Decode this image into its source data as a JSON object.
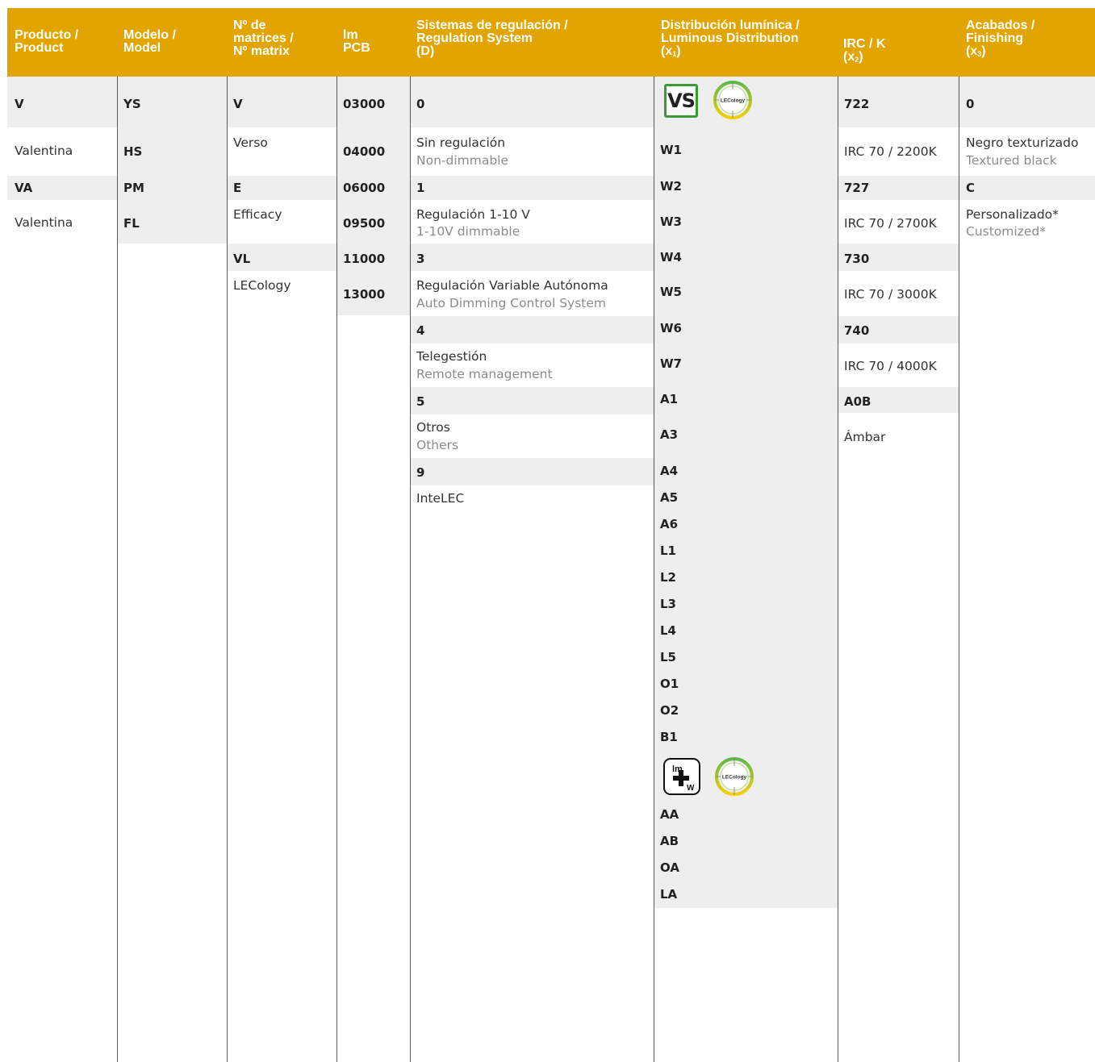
{
  "headers": {
    "product": [
      "Producto /",
      "Product"
    ],
    "model": [
      "Modelo /",
      "Model"
    ],
    "matrix": [
      "Nº de",
      "matrices /",
      "Nº matrix"
    ],
    "lm": [
      "lm",
      "PCB"
    ],
    "regulation": [
      "Sistemas de regulación /",
      "Regulation System",
      "(D)"
    ],
    "distribution": [
      "Distribución lumínica /",
      "Luminous Distribution",
      "(x",
      "1",
      ")"
    ],
    "irc": [
      "IRC / K",
      "(x",
      "2",
      ")"
    ],
    "finishing": [
      "Acabados /",
      "Finishing",
      "(x",
      "3",
      ")"
    ]
  },
  "product": {
    "c1": "V",
    "t1": "Valentina",
    "c2": "VA",
    "t2": "Valentina"
  },
  "model": {
    "m1": "YS",
    "m2": "HS",
    "m3": "PM",
    "m4": "FL"
  },
  "matrix": {
    "c1": "V",
    "t1": "Verso",
    "c2": "E",
    "t2": "Efficacy",
    "c3": "VL",
    "t3": "LECology"
  },
  "lm": [
    "03000",
    "04000",
    "06000",
    "09500",
    "11000",
    "13000"
  ],
  "regulation": {
    "c0": "0",
    "t0": "Sin regulación",
    "s0": "Non-dimmable",
    "c1": "1",
    "t1": "Regulación 1-10 V",
    "s1": "1-10V dimmable",
    "c3": "3",
    "t3": "Regulación Variable Autónoma",
    "s3": "Auto Dimming Control System",
    "c4": "4",
    "t4": "Telegestión",
    "s4": "Remote management",
    "c5": "5",
    "t5": "Otros",
    "s5": "Others",
    "c9": "9",
    "t9": "InteLEC"
  },
  "distribution": {
    "vs_badge": "VS",
    "lecology_icon_label": "LECology",
    "lmw_badge": {
      "top": "lm",
      "bottom": "W"
    },
    "group1": [
      "W1",
      "W2",
      "W3",
      "W4",
      "W5",
      "W6",
      "W7",
      "A1",
      "A3",
      "A4",
      "A5",
      "A6",
      "L1",
      "L2",
      "L3",
      "L4",
      "L5",
      "O1",
      "O2",
      "B1"
    ],
    "group2": [
      "AA",
      "AB",
      "OA",
      "LA"
    ]
  },
  "irc": {
    "c1": "722",
    "t1": "IRC 70 / 2200K",
    "c2": "727",
    "t2": "IRC 70 / 2700K",
    "c3": "730",
    "t3": "IRC 70 / 3000K",
    "c4": "740",
    "t4": "IRC 70 / 4000K",
    "c5": "A0B",
    "t5": "Ámbar"
  },
  "finishing": {
    "c1": "0",
    "t1": "Negro texturizado",
    "s1": "Textured black",
    "c2": "C",
    "t2": "Personalizado*",
    "s2": "Customized*"
  },
  "colors": {
    "header": "#e2a500",
    "row_shade": "#eeeeee",
    "vs_green": "#3a9b35"
  }
}
